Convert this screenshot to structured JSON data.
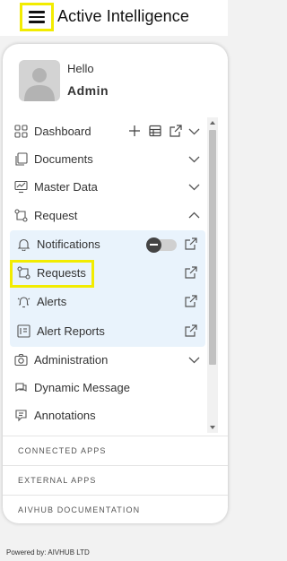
{
  "header": {
    "app_title": "Active Intelligence",
    "menu_icon": "hamburger-menu-icon"
  },
  "profile": {
    "greeting": "Hello",
    "user_name": "Admin",
    "avatar_icon": "user-avatar-icon"
  },
  "menu": {
    "items": [
      {
        "label": "Dashboard",
        "icon": "dashboard-icon",
        "actions": [
          "plus-icon",
          "table-icon",
          "external-link-icon",
          "chevron-down-icon"
        ]
      },
      {
        "label": "Documents",
        "icon": "documents-icon"
      },
      {
        "label": "Master Data",
        "icon": "chart-icon"
      },
      {
        "label": "Request",
        "icon": "request-icon",
        "expanded": true
      },
      {
        "label": "Administration",
        "icon": "camera-icon"
      },
      {
        "label": "Dynamic Message",
        "icon": "message-icon"
      },
      {
        "label": "Annotations",
        "icon": "annotation-icon"
      }
    ],
    "sub_items": [
      {
        "label": "Notifications",
        "icon": "bell-icon",
        "toggle_on": false
      },
      {
        "label": "Requests",
        "icon": "request-icon"
      },
      {
        "label": "Alerts",
        "icon": "alert-icon"
      },
      {
        "label": "Alert Reports",
        "icon": "report-icon"
      }
    ]
  },
  "links": [
    "CONNECTED APPS",
    "EXTERNAL APPS",
    "AIVHUB DOCUMENTATION"
  ],
  "footer": {
    "text": "Powered by: AIVHUB LTD"
  },
  "colors": {
    "highlight": "#f2ec00",
    "submenu_bg": "#e9f3fc"
  }
}
